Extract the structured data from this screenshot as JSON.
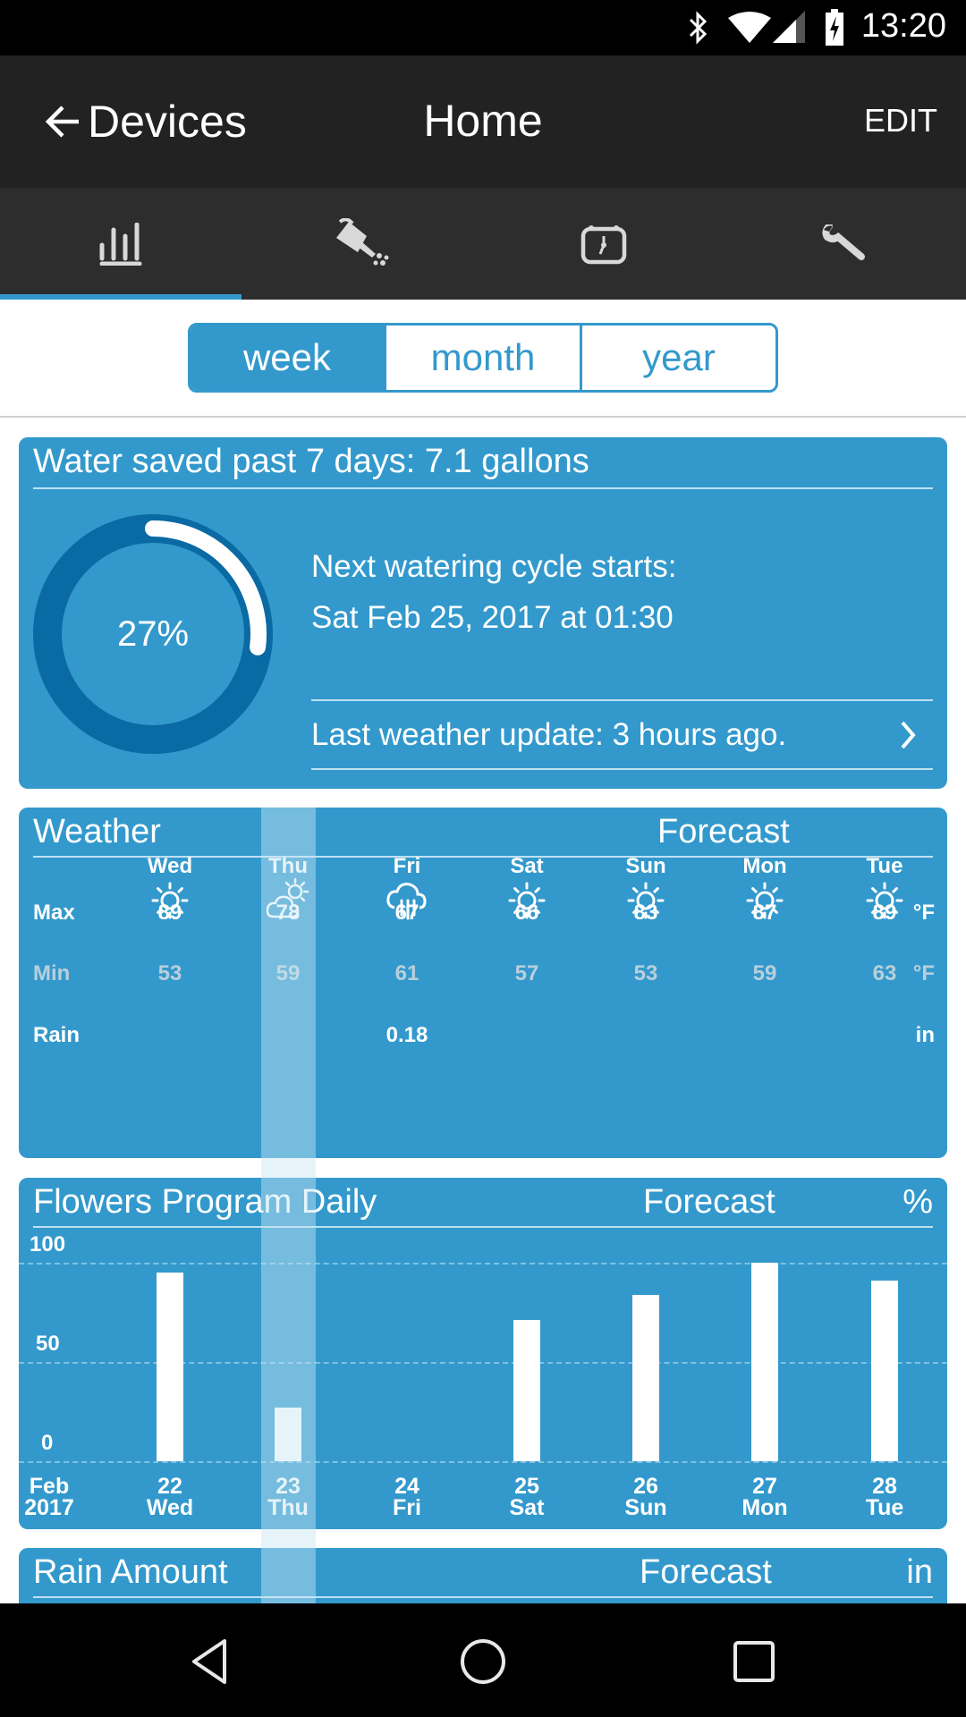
{
  "status_bar": {
    "time": "13:20",
    "icons": [
      "bluetooth-icon",
      "wifi-icon",
      "cell-signal-icon",
      "battery-charging-icon"
    ]
  },
  "app_bar": {
    "back_label": "Devices",
    "title": "Home",
    "edit_label": "EDIT"
  },
  "tabs": [
    {
      "icon": "bar-chart-icon",
      "active": true
    },
    {
      "icon": "watering-can-icon",
      "active": false
    },
    {
      "icon": "calendar-clock-icon",
      "active": false
    },
    {
      "icon": "wrench-icon",
      "active": false
    }
  ],
  "period_selector": {
    "options": [
      "week",
      "month",
      "year"
    ],
    "selected": "week"
  },
  "summary_card": {
    "title": "Water saved past 7 days: 7.1 gallons",
    "progress_percent": 27,
    "progress_label": "27%",
    "next_cycle_label": "Next watering cycle starts:",
    "next_cycle_value": "Sat Feb 25, 2017 at 01:30",
    "weather_update": "Last weather update: 3 hours ago."
  },
  "weather_card": {
    "title": "Weather",
    "forecast_label": "Forecast",
    "row_labels": {
      "max": "Max",
      "min": "Min",
      "rain": "Rain"
    },
    "units": {
      "max": "°F",
      "min": "°F",
      "rain": "in"
    },
    "days": [
      {
        "day": "Wed",
        "icon": "sun-icon",
        "max": "89",
        "min": "53",
        "rain": ""
      },
      {
        "day": "Thu",
        "icon": "partly-cloudy-icon",
        "max": "78",
        "min": "59",
        "rain": ""
      },
      {
        "day": "Fri",
        "icon": "rain-cloud-icon",
        "max": "67",
        "min": "61",
        "rain": "0.18"
      },
      {
        "day": "Sat",
        "icon": "sun-icon",
        "max": "66",
        "min": "57",
        "rain": ""
      },
      {
        "day": "Sun",
        "icon": "sun-icon",
        "max": "83",
        "min": "53",
        "rain": ""
      },
      {
        "day": "Mon",
        "icon": "sun-icon",
        "max": "87",
        "min": "59",
        "rain": ""
      },
      {
        "day": "Tue",
        "icon": "sun-icon",
        "max": "89",
        "min": "63",
        "rain": ""
      }
    ],
    "highlighted_day": "Thu"
  },
  "program_card": {
    "title": "Flowers Program Daily",
    "forecast_label": "Forecast",
    "unit": "%"
  },
  "rain_card": {
    "title": "Rain Amount",
    "forecast_label": "Forecast",
    "unit": "in"
  },
  "chart_data": {
    "type": "bar",
    "title": "Flowers Program Daily",
    "ylabel": "%",
    "xlabel": "",
    "ylim": [
      0,
      100
    ],
    "yticks": [
      "100",
      "50",
      "0"
    ],
    "grid": true,
    "x_origin_label": [
      "Feb",
      "2017"
    ],
    "categories": [
      [
        "22",
        "Wed"
      ],
      [
        "23",
        "Thu"
      ],
      [
        "24",
        "Fri"
      ],
      [
        "25",
        "Sat"
      ],
      [
        "26",
        "Sun"
      ],
      [
        "27",
        "Mon"
      ],
      [
        "28",
        "Tue"
      ]
    ],
    "values": [
      95,
      27,
      0,
      71,
      84,
      100,
      91
    ]
  },
  "nav_bar": {
    "buttons": [
      "back-nav-icon",
      "home-nav-icon",
      "recents-nav-icon"
    ]
  }
}
